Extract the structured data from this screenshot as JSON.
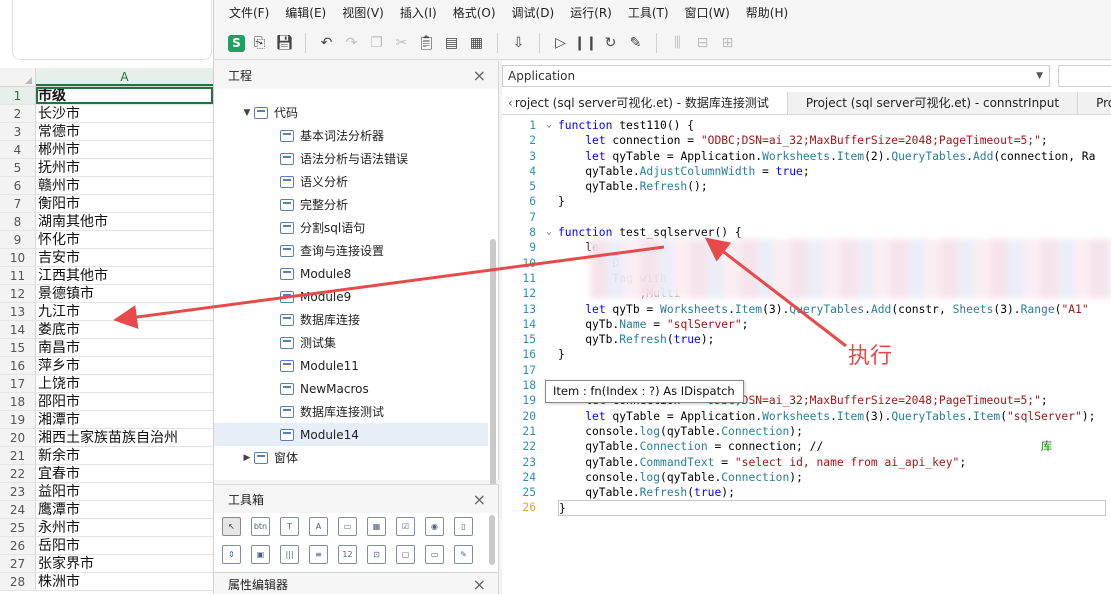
{
  "spreadsheet": {
    "column_header": "A",
    "rows": [
      {
        "n": "1",
        "v": "市级"
      },
      {
        "n": "2",
        "v": "长沙市"
      },
      {
        "n": "3",
        "v": "常德市"
      },
      {
        "n": "4",
        "v": "郴州市"
      },
      {
        "n": "5",
        "v": "抚州市"
      },
      {
        "n": "6",
        "v": "赣州市"
      },
      {
        "n": "7",
        "v": "衡阳市"
      },
      {
        "n": "8",
        "v": "湖南其他市"
      },
      {
        "n": "9",
        "v": "怀化市"
      },
      {
        "n": "10",
        "v": "吉安市"
      },
      {
        "n": "11",
        "v": "江西其他市"
      },
      {
        "n": "12",
        "v": "景德镇市"
      },
      {
        "n": "13",
        "v": "九江市"
      },
      {
        "n": "14",
        "v": "娄底市"
      },
      {
        "n": "15",
        "v": "南昌市"
      },
      {
        "n": "16",
        "v": "萍乡市"
      },
      {
        "n": "17",
        "v": "上饶市"
      },
      {
        "n": "18",
        "v": "邵阳市"
      },
      {
        "n": "19",
        "v": "湘潭市"
      },
      {
        "n": "20",
        "v": "湘西土家族苗族自治州"
      },
      {
        "n": "21",
        "v": "新余市"
      },
      {
        "n": "22",
        "v": "宜春市"
      },
      {
        "n": "23",
        "v": "益阳市"
      },
      {
        "n": "24",
        "v": "鹰潭市"
      },
      {
        "n": "25",
        "v": "永州市"
      },
      {
        "n": "26",
        "v": "岳阳市"
      },
      {
        "n": "27",
        "v": "张家界市"
      },
      {
        "n": "28",
        "v": "株洲市"
      }
    ]
  },
  "menu": [
    "文件(F)",
    "编辑(E)",
    "视图(V)",
    "插入(I)",
    "格式(O)",
    "调试(D)",
    "运行(R)",
    "工具(T)",
    "窗口(W)",
    "帮助(H)"
  ],
  "toolbar": {
    "logo": "S",
    "icons": [
      "save-as-icon",
      "save-icon",
      "undo-icon",
      "redo-icon",
      "copy-icon",
      "cut-icon",
      "paste-icon",
      "insert-module-icon",
      "export-icon",
      "import-icon",
      "run-icon",
      "pause-icon",
      "reset-icon",
      "design-icon",
      "align-icon",
      "center-icon",
      "distribute-icon"
    ]
  },
  "project_panel": {
    "title": "工程",
    "close": "×",
    "root": "代码",
    "items": [
      "基本词法分析器",
      "语法分析与语法错误",
      "语义分析",
      "完整分析",
      "分割sql语句",
      "查询与连接设置",
      "Module8",
      "Module9",
      "数据库连接",
      "测试集",
      "Module11",
      "NewMacros",
      "数据库连接测试",
      "Module14"
    ],
    "forms": "窗体"
  },
  "toolbox": {
    "title": "工具箱",
    "close": "×",
    "items": [
      "pointer",
      "btn",
      "T",
      "A",
      "frame",
      "list",
      "check",
      "radio",
      "scroll",
      "spin",
      "image",
      "bars",
      "list2",
      "num",
      "txt",
      "label",
      "folder",
      "edit"
    ]
  },
  "properties": {
    "title": "属性编辑器",
    "close": "×"
  },
  "editor": {
    "object_selector": "Application",
    "tabs": [
      "roject (sql server可视化.et) - 数据库连接测试",
      "Project (sql server可视化.et) - connstrInput",
      "Pro"
    ],
    "tooltip": "Item : fn(Index : ?) As IDispatch",
    "annotation": "执行"
  },
  "code_lines": [
    {
      "n": "1",
      "fold": "v",
      "html": "<span class='kw'>function</span> test110() {"
    },
    {
      "n": "2",
      "fold": "",
      "html": "    <span class='kw'>let</span> connection = <span class='st'>\"ODBC;DSN=ai_32;MaxBufferSize=2048;PageTimeout=5;\"</span>;"
    },
    {
      "n": "3",
      "fold": "",
      "html": "    <span class='kw'>let</span> qyTable = Application.<span class='pr'>Worksheets</span>.<span class='pr'>Item</span>(2).<span class='pr'>QueryTables</span>.<span class='pr'>Add</span>(connection, Ra"
    },
    {
      "n": "4",
      "fold": "",
      "html": "    qyTable.<span class='pr'>AdjustColumnWidth</span> = <span class='kw'>true</span>;"
    },
    {
      "n": "5",
      "fold": "",
      "html": "    qyTable.<span class='pr'>Refresh</span>();"
    },
    {
      "n": "6",
      "fold": "",
      "html": "}"
    },
    {
      "n": "7",
      "fold": "",
      "html": ""
    },
    {
      "n": "8",
      "fold": "v",
      "html": "<span class='kw'>function</span> test_sqlserver() {"
    },
    {
      "n": "9",
      "fold": "",
      "html": "    le"
    },
    {
      "n": "10",
      "fold": "",
      "html": "        D"
    },
    {
      "n": "11",
      "fold": "",
      "html": "        Tag with"
    },
    {
      "n": "12",
      "fold": "",
      "html": "            ;Multi"
    },
    {
      "n": "13",
      "fold": "",
      "html": "    <span class='kw'>let</span> qyTb = <span class='pr'>Worksheets</span>.<span class='pr'>Item</span>(3).<span class='pr'>QueryTables</span>.<span class='pr'>Add</span>(constr, <span class='pr'>Sheets</span>(3).<span class='pr'>Range</span>(<span class='st'>\"A1\"</span>"
    },
    {
      "n": "14",
      "fold": "",
      "html": "    qyTb.<span class='pr'>Name</span> = <span class='st'>\"sqlServer\"</span>;"
    },
    {
      "n": "15",
      "fold": "",
      "html": "    qyTb.<span class='pr'>Refresh</span>(<span class='kw'>true</span>);"
    },
    {
      "n": "16",
      "fold": "",
      "html": "}"
    },
    {
      "n": "17",
      "fold": "",
      "html": ""
    },
    {
      "n": "18",
      "fold": "v",
      "html": "<span class='kw'>function</span> changeConn() {"
    },
    {
      "n": "19",
      "fold": "",
      "html": "    <span class='kw'>let</span> connection = <span class='st'>\"ODBC;DSN=ai_32;MaxBufferSize=2048;PageTimeout=5;\"</span>;"
    },
    {
      "n": "20",
      "fold": "",
      "html": "    <span class='kw'>let</span> qyTable = Application.<span class='pr'>Worksheets</span>.<span class='pr'>Item</span>(3).<span class='pr'>QueryTables</span>.<span class='pr'>Item</span>(<span class='st'>\"sqlServer\"</span>);"
    },
    {
      "n": "21",
      "fold": "",
      "html": "    console.<span class='pr'>log</span>(qyTable.<span class='pr'>Connection</span>);"
    },
    {
      "n": "22",
      "fold": "",
      "html": "    qyTable.<span class='pr'>Connection</span> = connection; //                                <span style='color:#008000'>库</span>"
    },
    {
      "n": "23",
      "fold": "",
      "html": "    qyTable.<span class='pr'>CommandText</span> = <span class='st'>\"select id, name from ai_api_key\"</span>;"
    },
    {
      "n": "24",
      "fold": "",
      "html": "    console.<span class='pr'>log</span>(qyTable.<span class='pr'>Connection</span>);"
    },
    {
      "n": "25",
      "fold": "",
      "html": "    qyTable.<span class='pr'>Refresh</span>(<span class='kw'>true</span>);"
    },
    {
      "n": "26",
      "fold": "",
      "html": "}"
    }
  ],
  "colors": {
    "accent": "#217346",
    "annotation": "#e84a4a",
    "keyword": "#0000ff",
    "string": "#a31515"
  }
}
